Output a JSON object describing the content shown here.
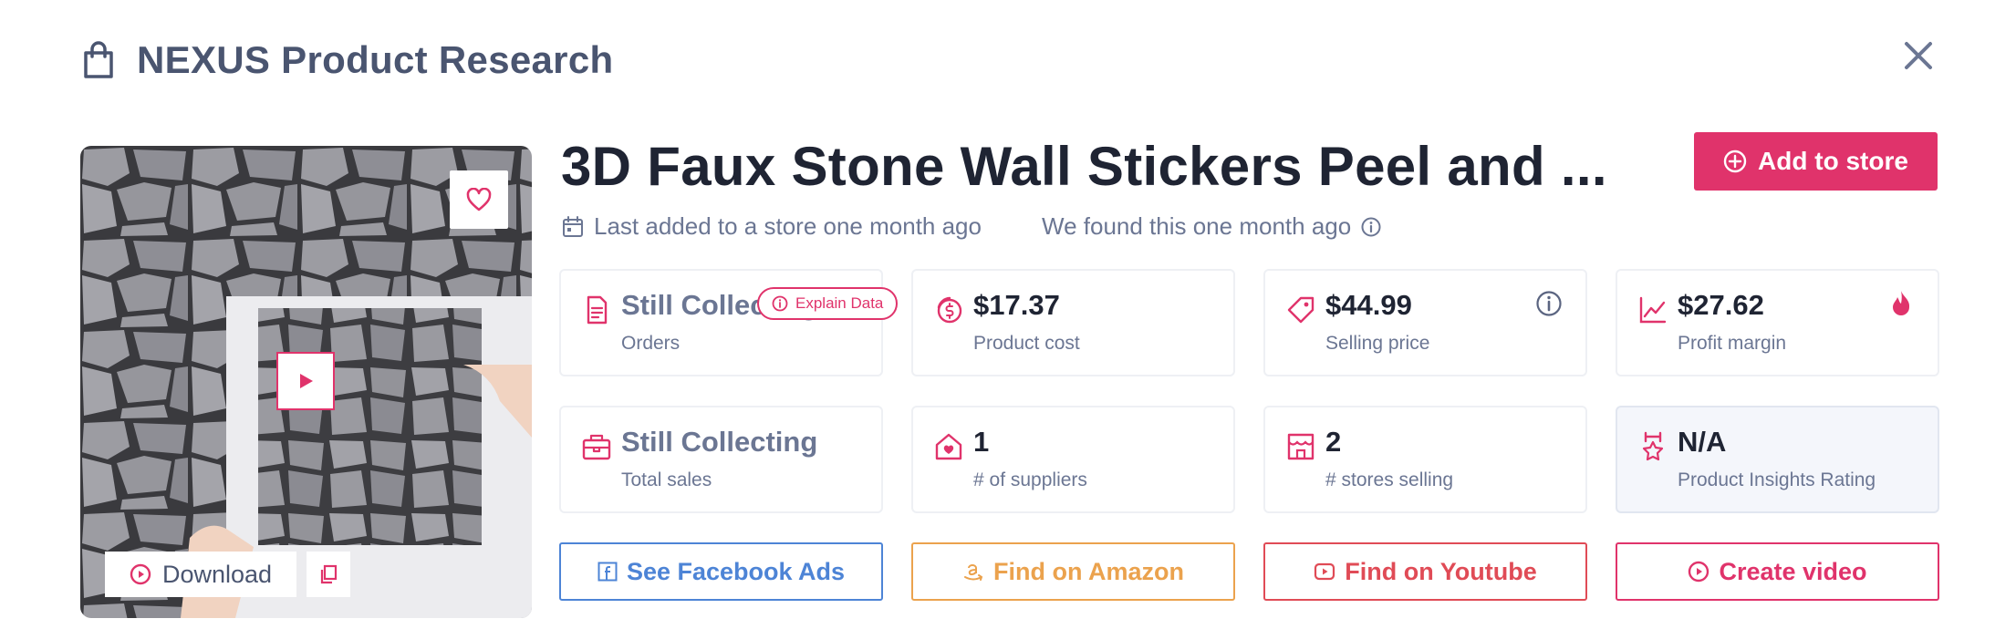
{
  "header": {
    "title": "NEXUS Product Research"
  },
  "product": {
    "title": "3D Faux Stone Wall Stickers Peel and ...",
    "add_to_store_label": "Add to store",
    "last_added": "Last added to a store one month ago",
    "found": "We found this one month ago"
  },
  "media": {
    "download_label": "Download"
  },
  "explain_label": "Explain Data",
  "stats": [
    {
      "value": "Still Collecting",
      "label": "Orders",
      "icon": "document-icon"
    },
    {
      "value": "$17.37",
      "label": "Product cost",
      "icon": "dollar-coins-icon"
    },
    {
      "value": "$44.99",
      "label": "Selling price",
      "icon": "price-tag-icon"
    },
    {
      "value": "$27.62",
      "label": "Profit margin",
      "icon": "trend-chart-icon"
    },
    {
      "value": "Still Collecting",
      "label": "Total sales",
      "icon": "register-icon"
    },
    {
      "value": "1",
      "label": "# of suppliers",
      "icon": "home-heart-icon"
    },
    {
      "value": "2",
      "label": "# stores selling",
      "icon": "storefront-icon"
    },
    {
      "value": "N/A",
      "label": "Product Insights Rating",
      "icon": "award-icon"
    }
  ],
  "actions": {
    "facebook": "See Facebook Ads",
    "amazon": "Find on Amazon",
    "youtube": "Find on Youtube",
    "video": "Create video"
  },
  "colors": {
    "accent": "#e0336b",
    "facebook": "#4d84d6",
    "amazon": "#eba24d",
    "youtube": "#e04b56",
    "text_muted": "#6b7693"
  }
}
